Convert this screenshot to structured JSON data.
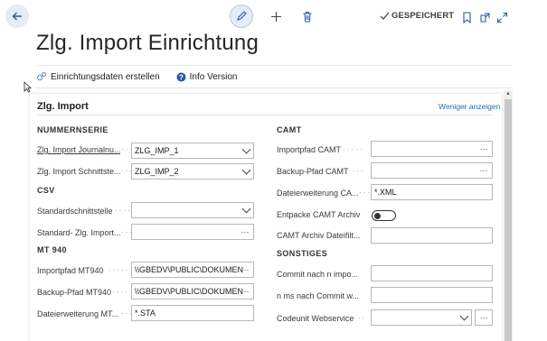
{
  "header": {
    "status": "GESPEICHERT"
  },
  "page": {
    "title": "Zlg. Import Einrichtung"
  },
  "actions": {
    "create_setup": "Einrichtungsdaten erstellen",
    "info_version": "Info Version"
  },
  "card": {
    "title": "Zlg. Import",
    "show_less": "Weniger anzeigen"
  },
  "left": {
    "nummernserie": {
      "heading": "NUMMERNSERIE",
      "journal_label": "Zlg. Import Journalnu...",
      "journal_value": "ZLG_IMP_1",
      "interface_label": "Zlg. Import Schnittste...",
      "interface_value": "ZLG_IMP_2"
    },
    "csv": {
      "heading": "CSV",
      "std_interface_label": "Standardschnittstelle",
      "std_interface_value": "",
      "std_import_label": "Standard- Zlg. Import...",
      "std_import_value": ""
    },
    "mt940": {
      "heading": "MT 940",
      "import_path_label": "Importpfad MT940",
      "import_path_value": "\\\\GBEDV\\PUBLIC\\DOKUMEN",
      "backup_path_label": "Backup-Pfad MT940",
      "backup_path_value": "\\\\GBEDV\\PUBLIC\\DOKUMEN",
      "ext_label": "Dateierweiterung MT...",
      "ext_value": "*.STA"
    }
  },
  "right": {
    "camt": {
      "heading": "CAMT",
      "import_path_label": "Importpfad CAMT",
      "import_path_value": "",
      "backup_path_label": "Backup-Pfad CAMT",
      "backup_path_value": "",
      "ext_label": "Dateierweiterung CA...",
      "ext_value": "*.XML",
      "unpack_label": "Entpacke CAMT Archiv",
      "unpack_value": false,
      "archive_filter_label": "CAMT Archiv Dateifilt...",
      "archive_filter_value": ""
    },
    "sonstiges": {
      "heading": "SONSTIGES",
      "commit_label": "Commit nach n impo...",
      "commit_value": "",
      "ms_label": "n ms nach Commit w...",
      "ms_value": "",
      "codeunit_label": "Codeunit Webservice",
      "codeunit_value": ""
    }
  },
  "colors": {
    "accent": "#1f6fb5",
    "button_bg": "#e3ecf7"
  }
}
